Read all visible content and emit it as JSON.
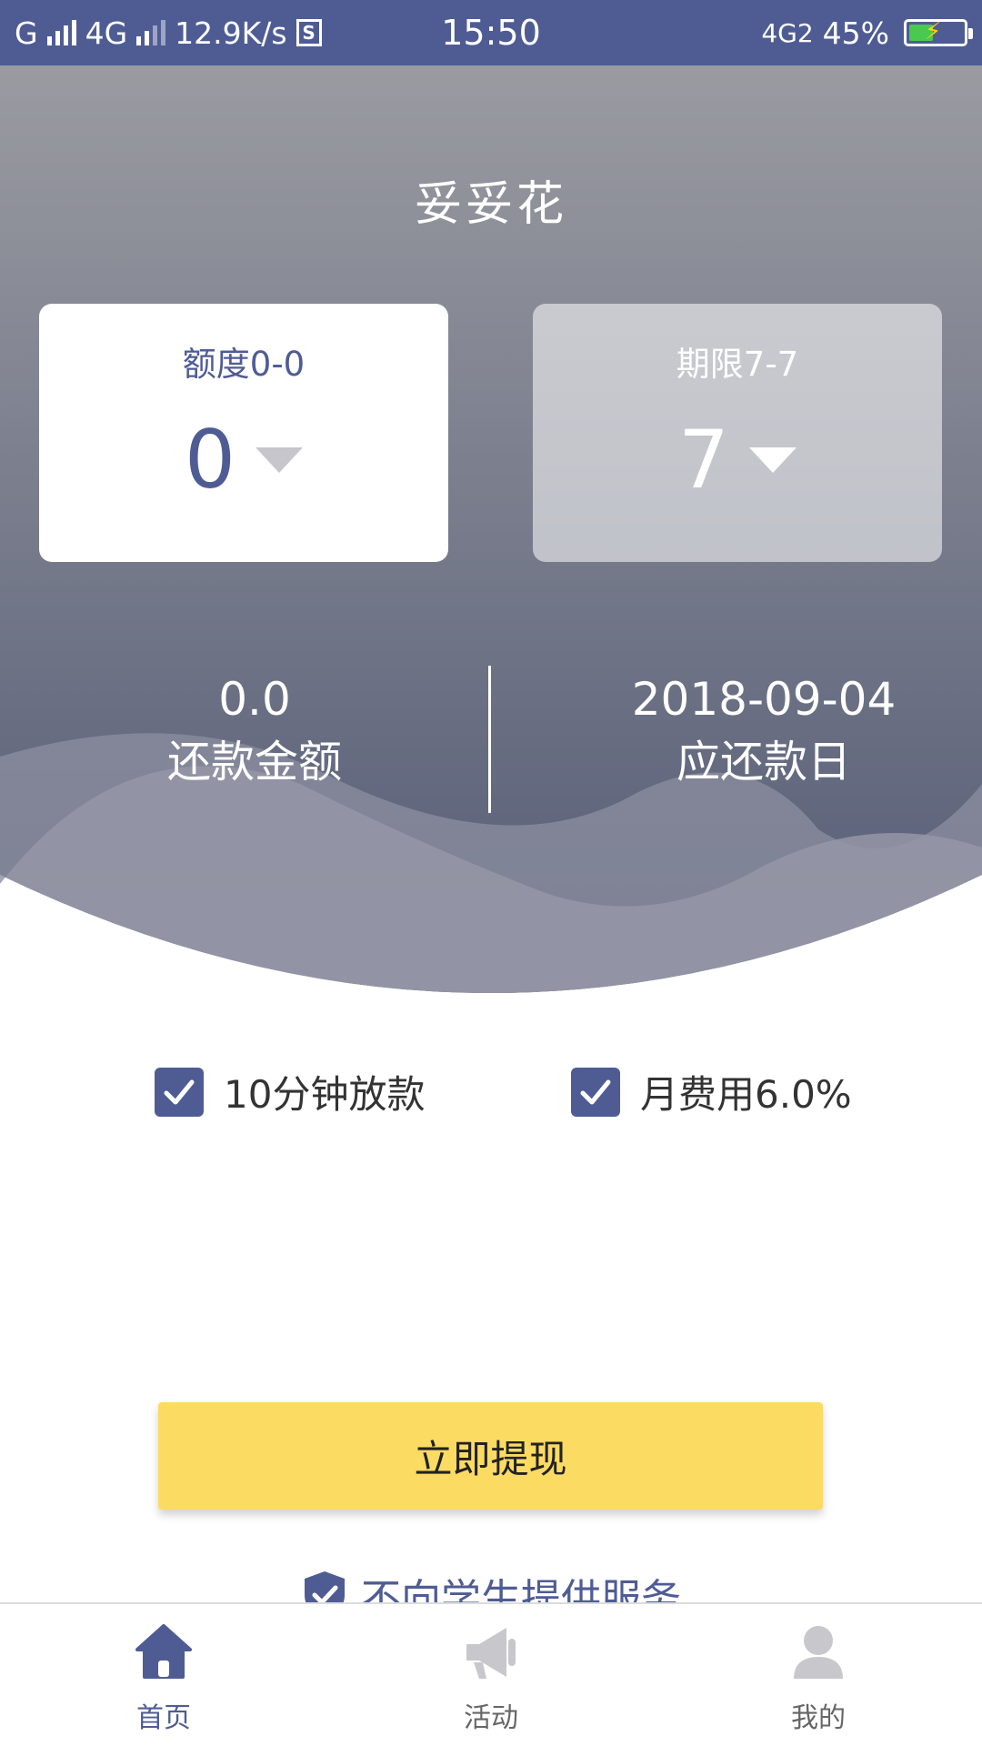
{
  "status_bar": {
    "carrier": "G",
    "network": "4G",
    "speed": "12.9K/s",
    "time": "15:50",
    "network_right": "4G2",
    "battery": "45%"
  },
  "header": {
    "title": "妥妥花"
  },
  "amount_card": {
    "label": "额度0-0",
    "value": "0"
  },
  "term_card": {
    "label": "期限7-7",
    "value": "7"
  },
  "repay_amount": {
    "value": "0.0",
    "label": "还款金额"
  },
  "repay_date": {
    "value": "2018-09-04",
    "label": "应还款日"
  },
  "options": [
    {
      "label": "10分钟放款",
      "checked": true
    },
    {
      "label": "月费用6.0%",
      "checked": true
    }
  ],
  "cta": {
    "label": "立即提现"
  },
  "notice": {
    "text": "不向学生提供服务"
  },
  "tabs": [
    {
      "label": "首页",
      "icon": "home-icon",
      "active": true
    },
    {
      "label": "活动",
      "icon": "megaphone-icon",
      "active": false
    },
    {
      "label": "我的",
      "icon": "user-icon",
      "active": false
    }
  ],
  "colors": {
    "primary": "#4f5c94",
    "cta": "#fcdb63",
    "hero_top": "#9a9ba1",
    "hero_bottom": "#545b75"
  }
}
